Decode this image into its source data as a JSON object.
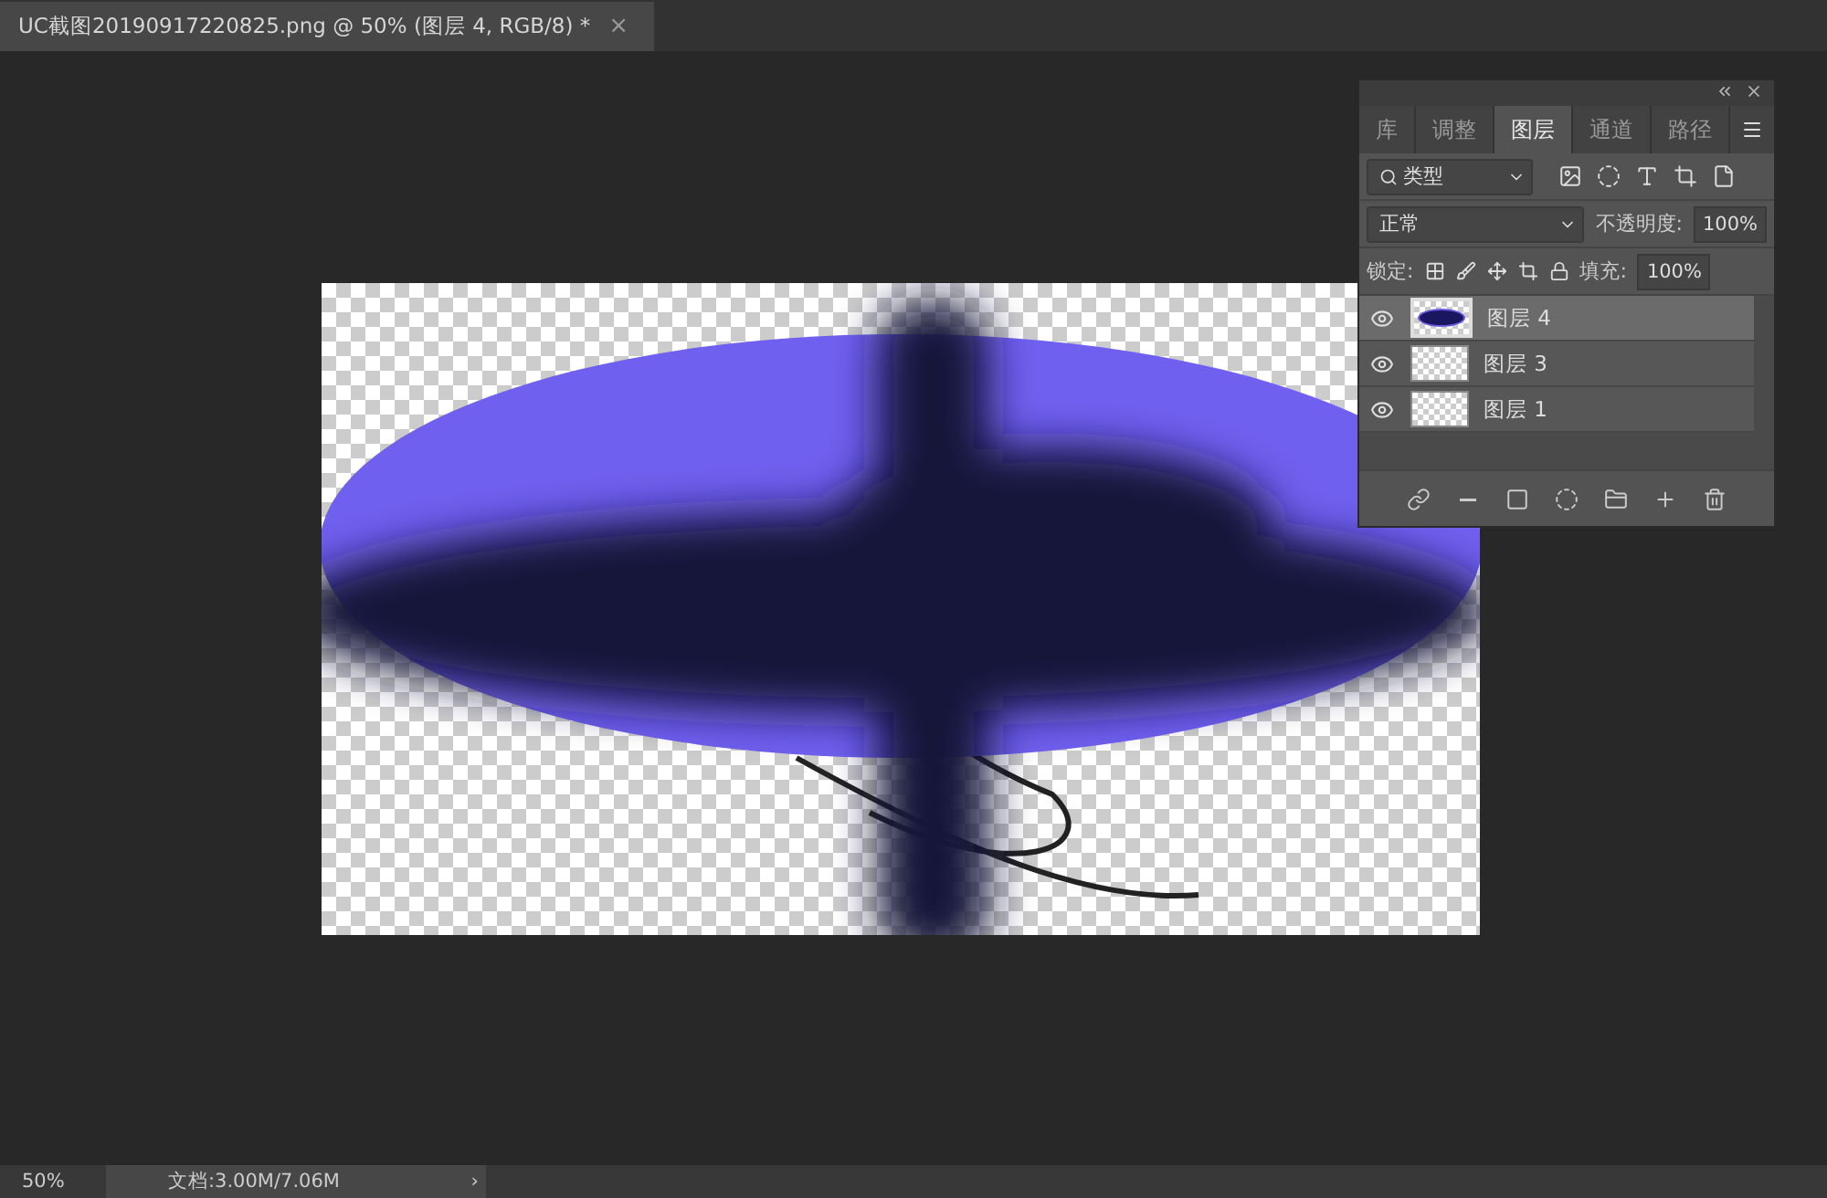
{
  "document_tab": {
    "title": "UC截图20190917220825.png @ 50% (图层 4, RGB/8) *",
    "close": "×"
  },
  "layers_panel": {
    "tabs": [
      {
        "label": "库",
        "selected": false
      },
      {
        "label": "调整",
        "selected": false
      },
      {
        "label": "图层",
        "selected": true
      },
      {
        "label": "通道",
        "selected": false
      },
      {
        "label": "路径",
        "selected": false
      }
    ],
    "filter": "类型",
    "blend_mode": "正常",
    "opacity_label": "不透明度:",
    "opacity": "100%",
    "lock_label": "锁定:",
    "fill_label": "填充:",
    "fill": "100%",
    "layers": [
      {
        "name": "图层 4",
        "selected": true,
        "visible": true
      },
      {
        "name": "图层 3",
        "selected": false,
        "visible": true
      },
      {
        "name": "图层 1",
        "selected": false,
        "visible": true
      }
    ]
  },
  "status_bar": {
    "zoom": "50%",
    "doc_info": "文档:3.00M/7.06M",
    "arrow": "›"
  }
}
